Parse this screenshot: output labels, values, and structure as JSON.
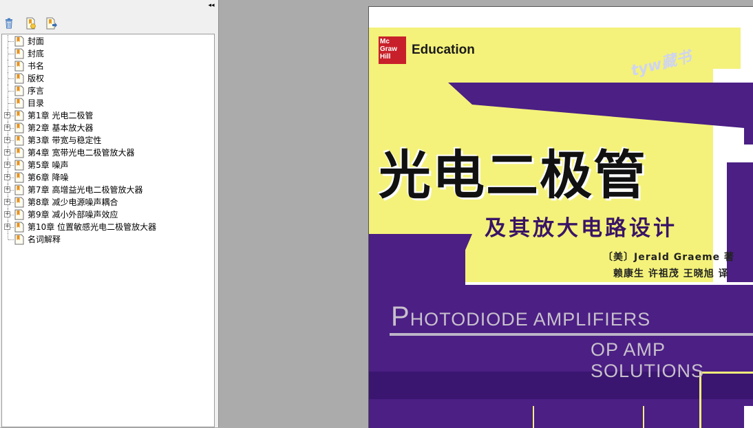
{
  "sidebar": {
    "collapse_glyph": "◂◂",
    "toolbar": [
      {
        "name": "delete-bookmark-icon"
      },
      {
        "name": "new-bookmark-icon"
      },
      {
        "name": "expand-bookmark-icon"
      }
    ],
    "bookmarks": [
      {
        "label": "封面",
        "expandable": false
      },
      {
        "label": "封底",
        "expandable": false
      },
      {
        "label": "书名",
        "expandable": false
      },
      {
        "label": "版权",
        "expandable": false
      },
      {
        "label": "序言",
        "expandable": false
      },
      {
        "label": "目录",
        "expandable": false
      },
      {
        "label": "第1章 光电二极管",
        "expandable": true
      },
      {
        "label": "第2章 基本放大器",
        "expandable": true
      },
      {
        "label": "第3章 带宽与稳定性",
        "expandable": true
      },
      {
        "label": "第4章 宽带光电二极管放大器",
        "expandable": true
      },
      {
        "label": "第5章 噪声",
        "expandable": true
      },
      {
        "label": "第6章 降噪",
        "expandable": true
      },
      {
        "label": "第7章 高增益光电二极管放大器",
        "expandable": true
      },
      {
        "label": "第8章 减少电源噪声耦合",
        "expandable": true
      },
      {
        "label": "第9章 减小外部噪声效应",
        "expandable": true
      },
      {
        "label": "第10章 位置敏感光电二极管放大器",
        "expandable": true
      },
      {
        "label": "名词解释",
        "expandable": false
      }
    ]
  },
  "cover": {
    "publisher_logo_lines": [
      "Mc",
      "Graw",
      "Hill"
    ],
    "publisher_line": "Education",
    "watermark": "tyw藏书",
    "title_cn": "光电二极管",
    "subtitle_cn": "及其放大电路设计",
    "author_line": "〔美〕Jerald Graeme 著",
    "translators_line": "赖康生 许祖茂 王晓旭 译",
    "title_en_cap": "P",
    "title_en_rest": "HOTODIODE AMPLIFIERS",
    "subtitle_en": "OP AMP SOLUTIONS"
  },
  "colors": {
    "cover_yellow": "#f4f27a",
    "cover_purple": "#4b1f84",
    "cover_dark_purple": "#2e0f56",
    "page_bg": "#ababab"
  }
}
